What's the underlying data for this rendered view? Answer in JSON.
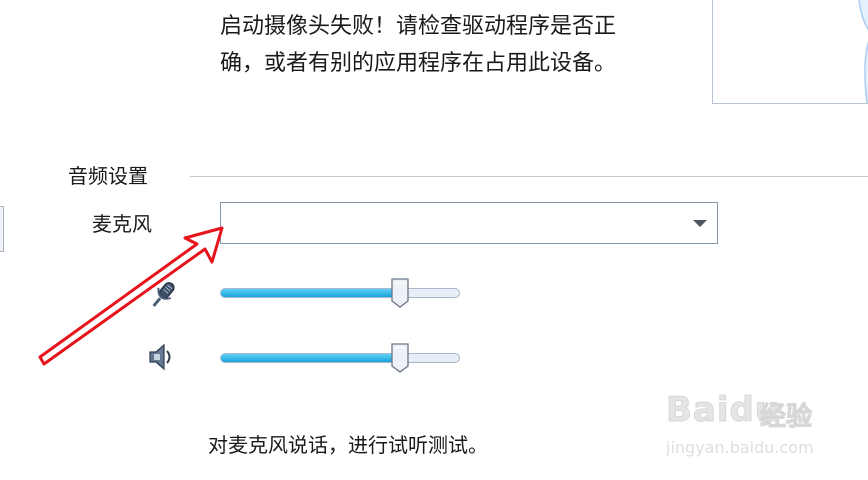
{
  "camera": {
    "error_line1": "启动摄像头失败！请检查驱动程序是否正",
    "error_line2": "确，或者有别的应用程序在占用此设备。"
  },
  "audio_settings": {
    "section_title": "音频设置",
    "microphone_label": "麦克风",
    "microphone_select_value": "",
    "microphone_icon": "microphone-icon",
    "speaker_icon": "speaker-icon",
    "microphone_volume_level": 0.75,
    "speaker_volume_level": 0.75,
    "test_hint": "对麦克风说话，进行试听测试。"
  },
  "annotation": {
    "arrow_color": "#e8141b"
  },
  "watermark": {
    "logo_text": "Baidu",
    "brand_text": "经验",
    "url_text": "jingyan.baidu.com"
  },
  "colors": {
    "slider_fill": "#1aa3db",
    "slider_track": "#e6eef7",
    "border": "#8497ad"
  }
}
